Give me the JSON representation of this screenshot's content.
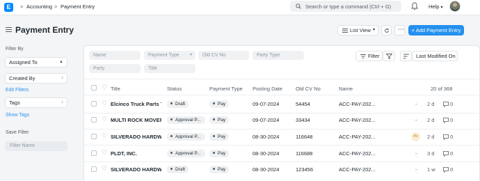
{
  "navbar": {
    "logo_letter": "E",
    "breadcrumb": [
      "Accounting",
      "Payment Entry"
    ],
    "search_placeholder": "Search or type a command (Ctrl + G)",
    "help_label": "Help"
  },
  "header": {
    "title": "Payment Entry",
    "view_button": "List View",
    "add_button": "+ Add Payment Entry"
  },
  "sidebar": {
    "filter_by_label": "Filter By",
    "assigned_to": "Assigned To",
    "created_by": "Created By",
    "edit_filters": "Edit Filters",
    "tags": "Tags",
    "show_tags": "Show Tags",
    "save_filter_label": "Save Filter",
    "filter_name_placeholder": "Filter Name"
  },
  "filters": {
    "name": "Name",
    "payment_type": "Payment Type",
    "old_cv_no": "Old CV No",
    "party_type": "Party Type",
    "party": "Party",
    "title": "Title",
    "filter_button": "Filter",
    "sort_button": "Last Modified On"
  },
  "table": {
    "headers": {
      "title": "Title",
      "status": "Status",
      "payment_type": "Payment Type",
      "posting_date": "Posting Date",
      "old_cv_no": "Old CV No",
      "name": "Name"
    },
    "count": "20 of 368",
    "rows": [
      {
        "title": "Elcinco Truck Parts Tra",
        "status": "Draft",
        "payment_type": "Pay",
        "posting_date": "09-07-2024",
        "old_cv_no": "54454",
        "name": "ACC-PAY-202...",
        "assignee": "",
        "dash": "-",
        "age": "2 d",
        "comments": "0"
      },
      {
        "title": "MULTI ROCK MOVERS",
        "status": "Approval P...",
        "payment_type": "Pay",
        "posting_date": "09-07-2024",
        "old_cv_no": "33434",
        "name": "ACC-PAY-202...",
        "assignee": "",
        "dash": "-",
        "age": "2 d",
        "comments": "0"
      },
      {
        "title": "SILVERADO HARDWAF",
        "status": "Approval P...",
        "payment_type": "Pay",
        "posting_date": "08-30-2024",
        "old_cv_no": "116648",
        "name": "ACC-PAY-202...",
        "assignee": "AV",
        "dash": "",
        "age": "2 d",
        "comments": "0"
      },
      {
        "title": "PLDT, INC.",
        "status": "Approval P...",
        "payment_type": "Pay",
        "posting_date": "08-30-2024",
        "old_cv_no": "116688",
        "name": "ACC-PAY-202...",
        "assignee": "",
        "dash": "-",
        "age": "3 d",
        "comments": "0"
      },
      {
        "title": "SILVERADO HARDWAF",
        "status": "Draft",
        "payment_type": "Pay",
        "posting_date": "08-30-2024",
        "old_cv_no": "123456",
        "name": "ACC-PAY-202...",
        "assignee": "",
        "dash": "-",
        "age": "1 w",
        "comments": "0"
      }
    ]
  },
  "colors": {
    "primary": "#2490ef",
    "logo": "#0089ff",
    "link": "#2490ef"
  }
}
